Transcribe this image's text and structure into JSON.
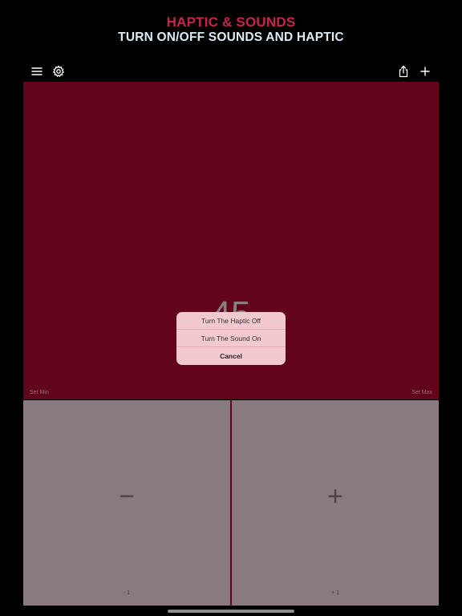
{
  "header": {
    "title": "HAPTIC & SOUNDS",
    "subtitle": "TURN ON/OFF SOUNDS AND HAPTIC"
  },
  "toolbar": {
    "left_icons": [
      "menu-icon",
      "gear-icon"
    ],
    "right_icons": [
      "share-icon",
      "plus-icon"
    ]
  },
  "counter": {
    "value": "45",
    "set_min_label": "Set Min",
    "set_max_label": "Set Max"
  },
  "pads": {
    "decrement_symbol": "−",
    "decrement_step": "- 1",
    "increment_symbol": "+",
    "increment_step": "+ 1"
  },
  "action_sheet": {
    "haptic_option": "Turn The Haptic Off",
    "sound_option": "Turn The Sound On",
    "cancel_label": "Cancel"
  },
  "colors": {
    "title": "#c8244a",
    "subtitle": "#dcecf4",
    "counter_background": "#62051a",
    "pad_background": "#897a80",
    "sheet_background": "#f2c9cf"
  }
}
